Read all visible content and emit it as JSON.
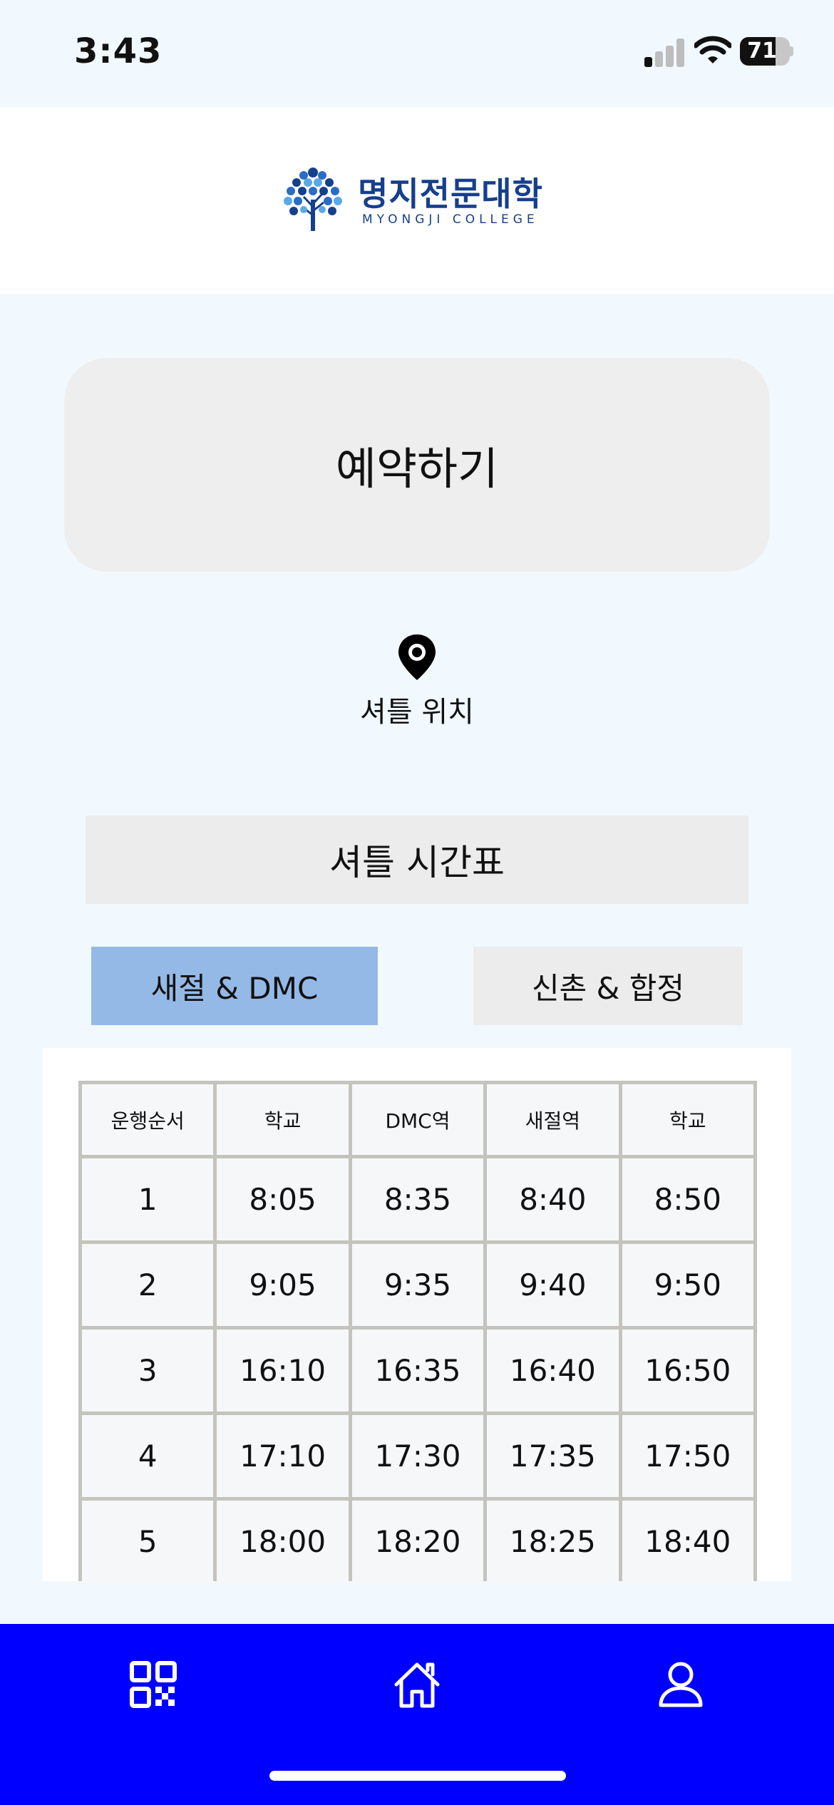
{
  "status_bar": {
    "time": "3:43",
    "battery_percent": "71",
    "signal_bars_active": 1
  },
  "header": {
    "logo_name_korean": "명지전문대학",
    "logo_name_english": "MYONGJI COLLEGE",
    "logo_icon": "tree-emblem-icon"
  },
  "reserve": {
    "label": "예약하기"
  },
  "location": {
    "icon": "map-pin-icon",
    "label": "셔틀 위치"
  },
  "timetable": {
    "title": "셔틀 시간표",
    "tabs": [
      {
        "label": "새절 & DMC",
        "selected": true
      },
      {
        "label": "신촌 & 합정",
        "selected": false
      }
    ],
    "columns": [
      "운행순서",
      "학교",
      "DMC역",
      "새절역",
      "학교"
    ],
    "rows": [
      [
        "1",
        "8:05",
        "8:35",
        "8:40",
        "8:50"
      ],
      [
        "2",
        "9:05",
        "9:35",
        "9:40",
        "9:50"
      ],
      [
        "3",
        "16:10",
        "16:35",
        "16:40",
        "16:50"
      ],
      [
        "4",
        "17:10",
        "17:30",
        "17:35",
        "17:50"
      ],
      [
        "5",
        "18:00",
        "18:20",
        "18:25",
        "18:40"
      ]
    ]
  },
  "bottom_nav": {
    "items": [
      {
        "icon": "qr-code-icon"
      },
      {
        "icon": "home-icon"
      },
      {
        "icon": "profile-icon"
      }
    ]
  },
  "colors": {
    "page_background": "#f2f9fe",
    "brand_navy": "#163f8c",
    "selected_tab": "#94b9e7",
    "bottom_nav": "#0000ff",
    "table_border": "#c4c3bd"
  }
}
